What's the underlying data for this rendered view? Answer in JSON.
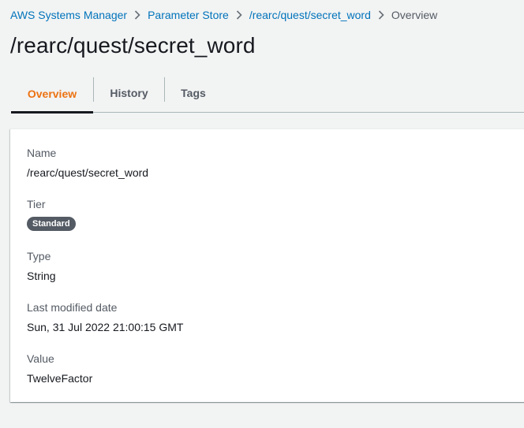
{
  "breadcrumb": {
    "items": [
      {
        "label": "AWS Systems Manager"
      },
      {
        "label": "Parameter Store"
      },
      {
        "label": "/rearc/quest/secret_word"
      },
      {
        "label": "Overview"
      }
    ]
  },
  "page": {
    "title": "/rearc/quest/secret_word"
  },
  "tabs": [
    {
      "label": "Overview",
      "active": true
    },
    {
      "label": "History",
      "active": false
    },
    {
      "label": "Tags",
      "active": false
    }
  ],
  "details": {
    "name_label": "Name",
    "name_value": "/rearc/quest/secret_word",
    "tier_label": "Tier",
    "tier_value": "Standard",
    "type_label": "Type",
    "type_value": "String",
    "modified_label": "Last modified date",
    "modified_value": "Sun, 31 Jul 2022 21:00:15 GMT",
    "value_label": "Value",
    "value_value": "TwelveFactor"
  },
  "colors": {
    "link": "#0073bb",
    "active_tab": "#ec7211",
    "badge": "#545b64"
  },
  "icons": {
    "breadcrumb_separator": "chevron-right-icon"
  }
}
